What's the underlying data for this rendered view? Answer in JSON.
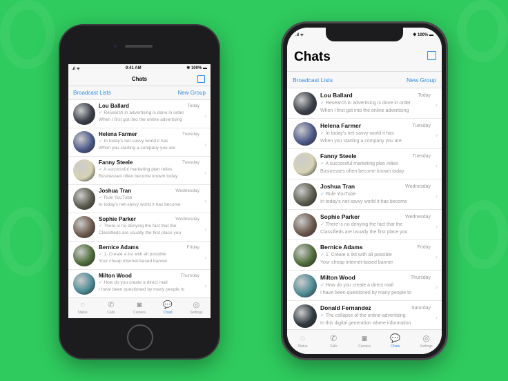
{
  "colors": {
    "background": "#2fcb5e",
    "accent": "#2e8de6"
  },
  "status_left": {
    "signal": ".ıl ᯤ",
    "time": "9:41 AM",
    "battery": "✱ 100% ▬"
  },
  "status_right": {
    "signal": ".ıl ᯤ",
    "battery": "✱ 100% ▬"
  },
  "nav": {
    "title": "Chats",
    "compose_icon": "compose-icon"
  },
  "links": {
    "broadcast": "Broadcast Lists",
    "new_group": "New Group"
  },
  "chats": [
    {
      "name": "Lou Ballard",
      "date": "Today",
      "preview": "Research in advertising is done in order",
      "second": "When I first got into the online advertising",
      "avatar": "#3a3f48"
    },
    {
      "name": "Helena Farmer",
      "date": "Tuesday",
      "preview": "In today's net-savvy world it has",
      "second": "When you starting a company you are",
      "avatar": "#4d5a8a"
    },
    {
      "name": "Fanny Steele",
      "date": "Tuesday",
      "preview": "A successful marketing plan relies",
      "second": "Businesses often become known today",
      "avatar": "#d6d2b4"
    },
    {
      "name": "Joshua Tran",
      "date": "Wednesday",
      "preview": "Rule YouTube",
      "second": "In today's net-savvy world it has become",
      "avatar": "#5b5b4e"
    },
    {
      "name": "Sophie Parker",
      "date": "Wednesday",
      "preview": "There is no denying the fact that the",
      "second": "Classifieds are usually the first place you",
      "avatar": "#6e5a4e"
    },
    {
      "name": "Bernice Adams",
      "date": "Friday",
      "preview": "1. Create a list with all possible",
      "second": "Your cheap internet-based banner",
      "avatar": "#4f6d3a"
    },
    {
      "name": "Milton Wood",
      "date": "Thursday",
      "preview": "How do you create a direct mail",
      "second": "I have been questioned by many people to",
      "avatar": "#4e8b95"
    },
    {
      "name": "Donald Fernandez",
      "date": "Saturday",
      "preview": "The collapse of the online-advertising",
      "second": "In this digital generation where information",
      "avatar": "#2f3a40"
    }
  ],
  "tabs": [
    {
      "label": "Status",
      "icon": "◌",
      "name": "status-icon"
    },
    {
      "label": "Calls",
      "icon": "✆",
      "name": "phone-icon"
    },
    {
      "label": "Camera",
      "icon": "◙",
      "name": "camera-icon"
    },
    {
      "label": "Chats",
      "icon": "💬",
      "name": "chats-icon",
      "active": true
    },
    {
      "label": "Settings",
      "icon": "◎",
      "name": "settings-icon"
    }
  ]
}
